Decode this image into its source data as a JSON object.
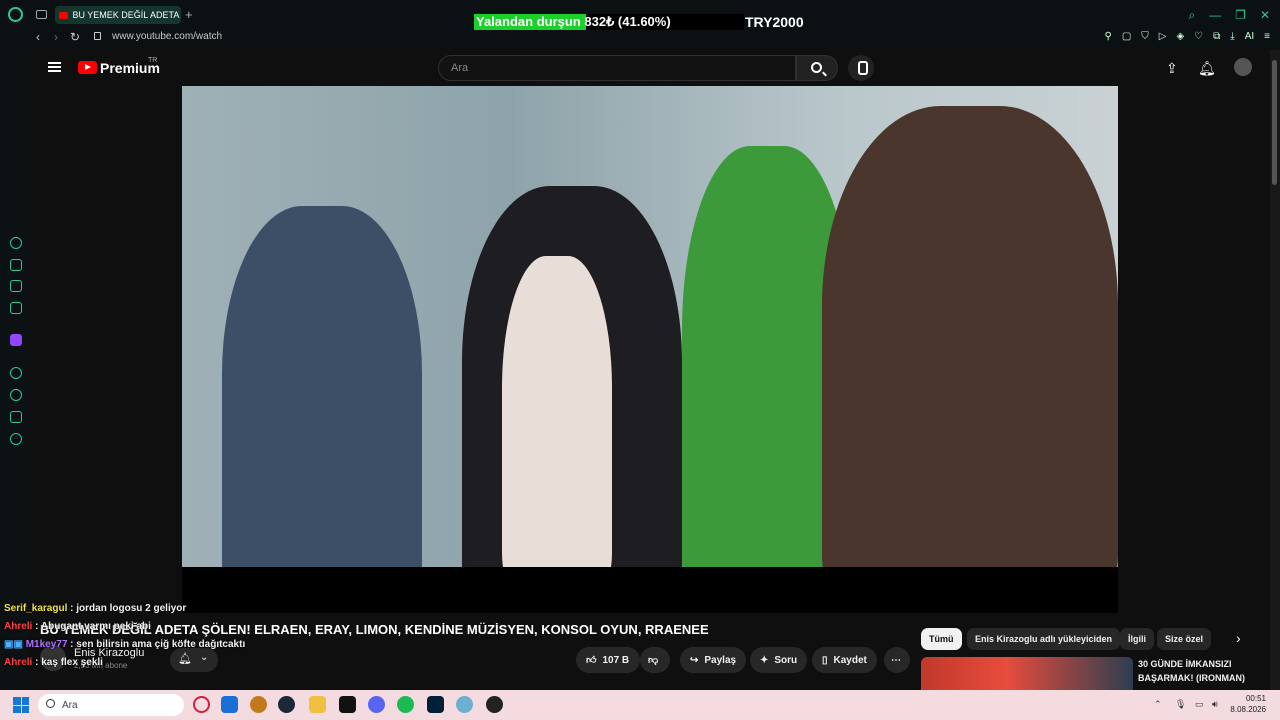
{
  "browser": {
    "tab_title": "BU YEMEK DEĞİL ADETA Ş",
    "url": "www.youtube.com/watch"
  },
  "stream_overlay": {
    "title_line": "Yalandan durşun 832₺ (41.60%)",
    "goal": "TRY2000",
    "progress_fraction": 0.416,
    "bar_color": "#1ccf2b"
  },
  "youtube": {
    "brand": "Premium",
    "region": "TR",
    "search_placeholder": "Ara",
    "video_title": "BU YEMEK DEĞİL ADETA ŞÖLEN! ELRAEN, ERAY, LIMON, KENDİNE MÜZİSYEN, KONSOL OYUN, RRAENEE",
    "channel": {
      "name": "Enis Kirazoglu",
      "subs": "2,93 Mn abone"
    },
    "actions": {
      "likes": "107 B",
      "share": "Paylaş",
      "ask": "Soru",
      "save": "Kaydet"
    },
    "chips": [
      "Tümü",
      "Enis Kirazoglu adlı yükleyiciden",
      "İlgili",
      "Size özel"
    ],
    "recommendation": {
      "title_line1": "30 GÜNDE İMKANSIZI",
      "title_line2": "BAŞARMAK! (IRONMAN)"
    }
  },
  "chat": [
    {
      "user": "Serif_karagul",
      "message": "jordan logosu 2 geliyor",
      "color": "yellow"
    },
    {
      "user": "Ahreli",
      "message": "Abugant varmı peki abi",
      "color": "red"
    },
    {
      "user": "M1key77",
      "message": "sen bilirsin ama çiğ köfte dağıtcaktı",
      "color": "purple"
    },
    {
      "user": "Ahreli",
      "message": "kaş flex şekli",
      "color": "red"
    }
  ],
  "taskbar": {
    "search_placeholder": "Ara",
    "time": "00:51",
    "date": "8.08.2026"
  }
}
